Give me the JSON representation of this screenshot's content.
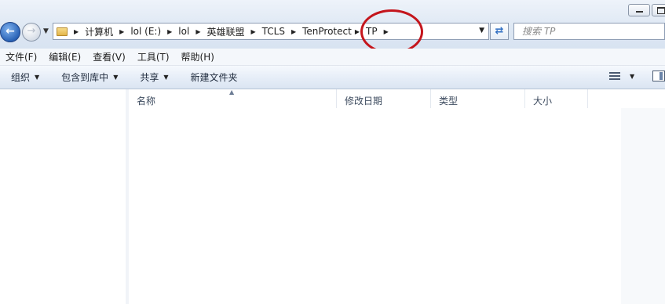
{
  "window": {
    "controls": {
      "minimize": "minimize",
      "maximize": "maximize"
    }
  },
  "nav": {
    "back_icon": "back-arrow-icon",
    "forward_icon": "forward-arrow-icon"
  },
  "address_bar": {
    "breadcrumbs": [
      {
        "label": "计算机"
      },
      {
        "label": "lol (E:)"
      },
      {
        "label": "lol"
      },
      {
        "label": "英雄联盟"
      },
      {
        "label": "TCLS"
      },
      {
        "label": "TenProtect"
      },
      {
        "label": "TP"
      }
    ]
  },
  "search": {
    "placeholder": "搜索 TP"
  },
  "menubar": {
    "items": [
      {
        "label": "文件(F)"
      },
      {
        "label": "编辑(E)"
      },
      {
        "label": "查看(V)"
      },
      {
        "label": "工具(T)"
      },
      {
        "label": "帮助(H)"
      }
    ]
  },
  "toolbar": {
    "organize": "组织",
    "include_in_library": "包含到库中",
    "share": "共享",
    "new_folder": "新建文件夹"
  },
  "columns": {
    "name": "名称",
    "date_modified": "修改日期",
    "type": "类型",
    "size": "大小"
  },
  "colors": {
    "annotation": "#c4151c",
    "accent": "#2a63b6"
  }
}
